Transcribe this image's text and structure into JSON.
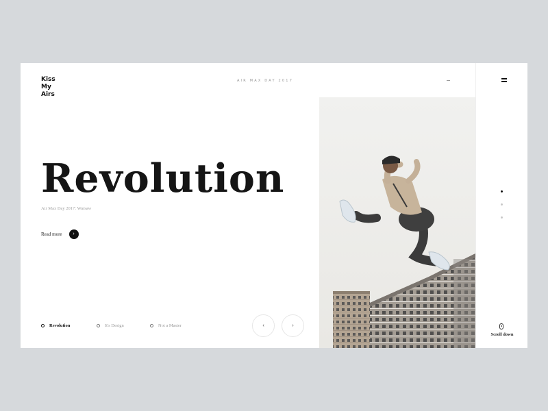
{
  "brand": {
    "lines": [
      "Kiss",
      "My",
      "Airs"
    ]
  },
  "header": {
    "title": "AIR MAX DAY 2017"
  },
  "hero": {
    "headline": "Revolution",
    "subtitle": "Air Max Day 2017: Warsaw",
    "read_more": "Read more"
  },
  "tabs": [
    {
      "label": "Revolution",
      "active": true
    },
    {
      "label": "It's Design",
      "active": false
    },
    {
      "label": "Not a Master",
      "active": false
    }
  ],
  "slider": {
    "prev_icon": "‹",
    "next_icon": "›"
  },
  "side": {
    "menu_icon": "hamburger-icon",
    "scroll_label": "Scroll down",
    "pagination": {
      "count": 3,
      "active": 1
    }
  },
  "image": {
    "description": "jumper-over-apartment-blocks"
  },
  "colors": {
    "background": "#d6d9dc",
    "card": "#ffffff",
    "text": "#151515",
    "muted": "#a0a0a0"
  }
}
